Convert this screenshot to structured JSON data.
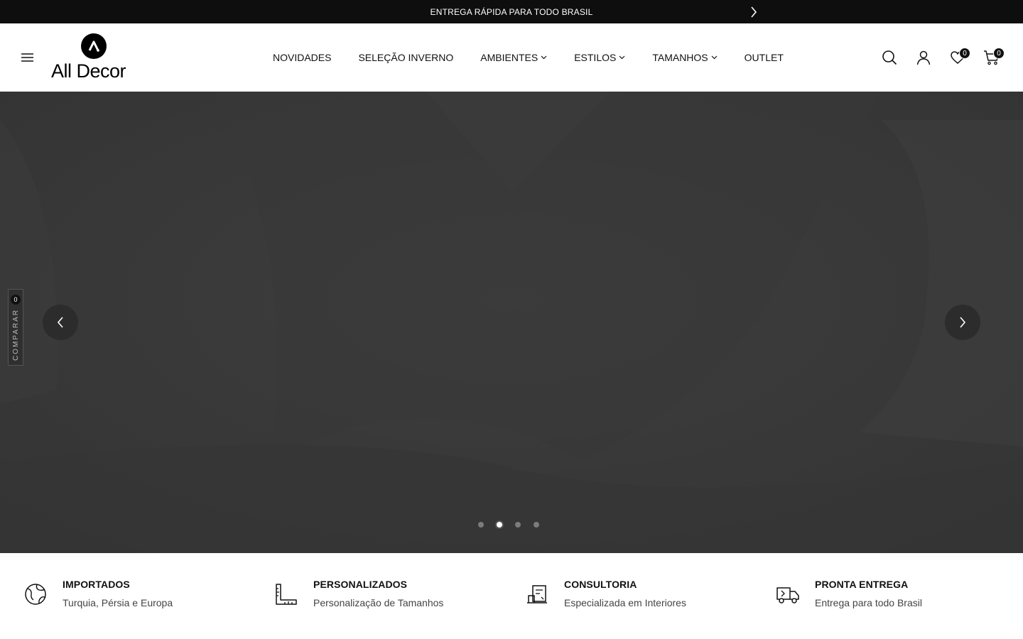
{
  "announcement": {
    "text": "ENTREGA RÁPIDA PARA TODO BRASIL"
  },
  "brand": {
    "name": "All Decor"
  },
  "nav": {
    "items": [
      {
        "label": "NOVIDADES",
        "dropdown": false
      },
      {
        "label": "SELEÇÃO INVERNO",
        "dropdown": false
      },
      {
        "label": "AMBIENTES",
        "dropdown": true
      },
      {
        "label": "ESTILOS",
        "dropdown": true
      },
      {
        "label": "TAMANHOS",
        "dropdown": true
      },
      {
        "label": "OUTLET",
        "dropdown": false
      }
    ]
  },
  "header_icons": {
    "wishlist_count": "0",
    "cart_count": "0"
  },
  "compare": {
    "label": "COMPARAR",
    "count": "0"
  },
  "slider": {
    "slide_count": 4,
    "active_index": 1
  },
  "features": [
    {
      "icon": "globe-icon",
      "title": "IMPORTADOS",
      "subtitle": "Turquia, Pérsia e Europa"
    },
    {
      "icon": "ruler-icon",
      "title": "PERSONALIZADOS",
      "subtitle": "Personalização de Tamanhos"
    },
    {
      "icon": "consulting-icon",
      "title": "CONSULTORIA",
      "subtitle": "Especializada em Interiores"
    },
    {
      "icon": "truck-icon",
      "title": "PRONTA ENTREGA",
      "subtitle": "Entrega para todo Brasil"
    }
  ],
  "colors": {
    "top_bar": "#0e0e0e",
    "hero_overlay": "#3a3a3a",
    "text": "#111111"
  }
}
